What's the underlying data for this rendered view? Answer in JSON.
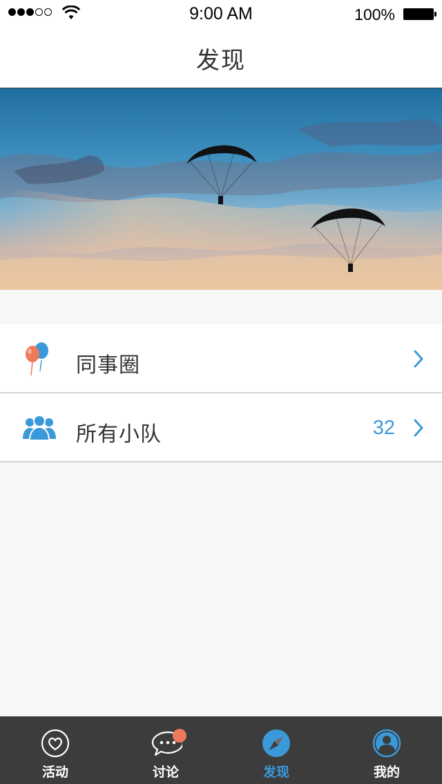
{
  "status_bar": {
    "time": "9:00 AM",
    "battery_percent": "100%"
  },
  "nav": {
    "title": "发现"
  },
  "menu": {
    "items": [
      {
        "label": "同事圈",
        "icon": "balloons-icon",
        "count": ""
      },
      {
        "label": "所有小队",
        "icon": "group-icon",
        "count": "32"
      }
    ]
  },
  "tabbar": {
    "tabs": [
      {
        "label": "活动",
        "icon": "heart-bubble-icon",
        "active": false
      },
      {
        "label": "讨论",
        "icon": "chat-bubble-icon",
        "active": false,
        "has_badge": true
      },
      {
        "label": "发现",
        "icon": "compass-icon",
        "active": true
      },
      {
        "label": "我的",
        "icon": "profile-icon",
        "active": false
      }
    ]
  },
  "colors": {
    "accent": "#3a9ad9",
    "badge": "#ef7a5b",
    "tabbar_bg": "#3c3c3c",
    "page_bg": "#f7f7f7"
  }
}
